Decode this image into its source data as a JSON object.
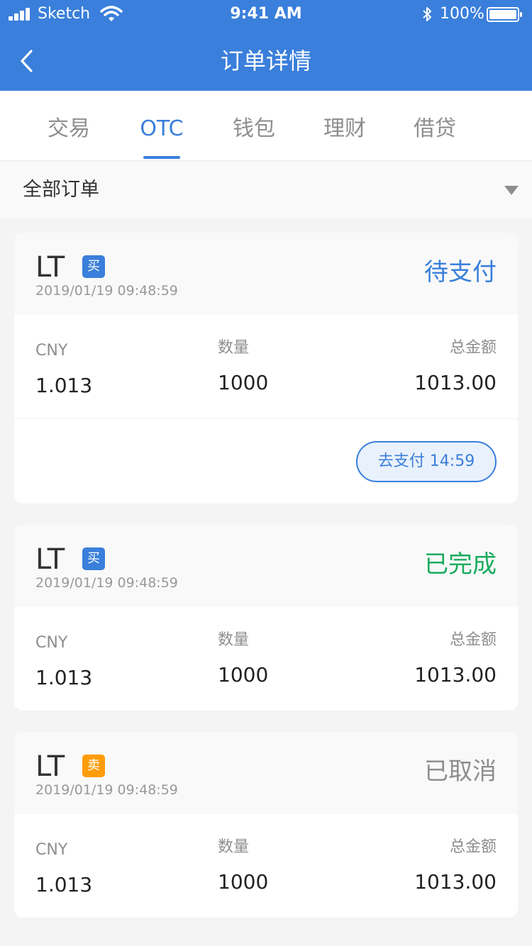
{
  "status_bar": {
    "carrier": "Sketch",
    "time": "9:41 AM",
    "battery_percent": "100%"
  },
  "nav": {
    "title": "订单详情"
  },
  "tabs": [
    {
      "label": "交易"
    },
    {
      "label": "OTC",
      "active": true
    },
    {
      "label": "钱包"
    },
    {
      "label": "理财"
    },
    {
      "label": "借贷"
    }
  ],
  "filter": {
    "label": "全部订单"
  },
  "columns": {
    "price_label": "CNY",
    "qty_label": "数量",
    "total_label": "总金额"
  },
  "orders": [
    {
      "coin": "LT",
      "side": "买",
      "time": "2019/01/19 09:48:59",
      "status": "待支付",
      "price": "1.013",
      "qty": "1000",
      "total": "1013.00",
      "action": "去支付 14:59"
    },
    {
      "coin": "LT",
      "side": "买",
      "time": "2019/01/19 09:48:59",
      "status": "已完成",
      "price": "1.013",
      "qty": "1000",
      "total": "1013.00"
    },
    {
      "coin": "LT",
      "side": "卖",
      "time": "2019/01/19 09:48:59",
      "status": "已取消",
      "price": "1.013",
      "qty": "1000",
      "total": "1013.00"
    }
  ],
  "colors": {
    "brand": "#3a7fdb",
    "pending": "#3a7fdb",
    "completed": "#1aab5e",
    "cancelled": "#8e8e8e",
    "sell_tag": "#ff9c0a"
  }
}
